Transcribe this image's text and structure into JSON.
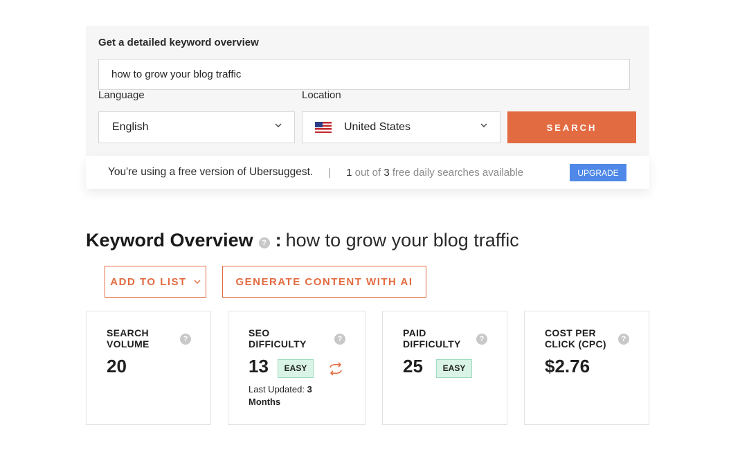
{
  "search_panel": {
    "title": "Get a detailed keyword overview",
    "keyword_value": "how to grow your blog traffic",
    "language_label": "Language",
    "language_value": "English",
    "location_label": "Location",
    "location_value": "United States",
    "search_label": "SEARCH"
  },
  "free_bar": {
    "message": "You're using a free version of Ubersuggest.",
    "separator": "|",
    "used": "1",
    "out_of": " out of ",
    "total": "3",
    "suffix": " free daily searches available",
    "upgrade_label": "UPGRADE"
  },
  "overview": {
    "title": "Keyword Overview",
    "help": "?",
    "colon": ":",
    "keyword": "how to grow your blog traffic",
    "add_to_list_label": "ADD TO LIST",
    "generate_label": "GENERATE CONTENT WITH AI"
  },
  "metrics": {
    "search_volume": {
      "label_line1": "SEARCH",
      "label_line2": "VOLUME",
      "value": "20"
    },
    "seo_difficulty": {
      "label_line1": "SEO",
      "label_line2": "DIFFICULTY",
      "value": "13",
      "badge": "EASY",
      "updated_prefix": "Last Updated: ",
      "updated_num": "3",
      "updated_unit": "Months"
    },
    "paid_difficulty": {
      "label_line1": "PAID",
      "label_line2": "DIFFICULTY",
      "value": "25",
      "badge": "EASY"
    },
    "cpc": {
      "label_line1": "COST PER",
      "label_line2": "CLICK (CPC)",
      "value": "$2.76"
    }
  },
  "colors": {
    "accent": "#e36b41",
    "upgrade": "#4f88e8",
    "easy_bg": "#d9f3e6"
  },
  "icons": [
    "chevron-down-icon",
    "us-flag-icon",
    "help-icon",
    "refresh-icon"
  ]
}
